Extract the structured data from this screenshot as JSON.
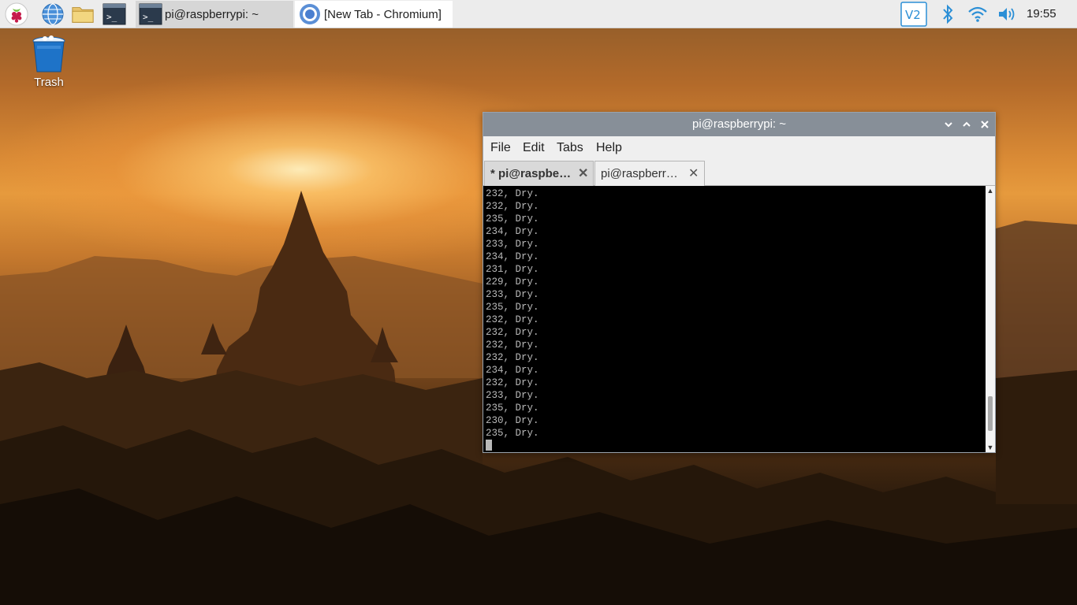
{
  "taskbar": {
    "launchers": [
      {
        "icon": "raspberry-menu-icon"
      },
      {
        "icon": "web-browser-icon"
      },
      {
        "icon": "file-manager-icon"
      },
      {
        "icon": "terminal-icon"
      }
    ],
    "tasks": [
      {
        "icon": "terminal-icon",
        "label": "pi@raspberrypi: ~"
      },
      {
        "icon": "chromium-icon",
        "label": "[New Tab - Chromium]"
      }
    ],
    "tray": [
      {
        "icon": "vnc-icon"
      },
      {
        "icon": "bluetooth-icon"
      },
      {
        "icon": "wifi-icon"
      },
      {
        "icon": "volume-icon"
      }
    ],
    "clock": "19:55"
  },
  "desktop": {
    "trash_label": "Trash"
  },
  "terminal": {
    "title": "pi@raspberrypi: ~",
    "menu": [
      "File",
      "Edit",
      "Tabs",
      "Help"
    ],
    "tabs": [
      {
        "label": "* pi@raspbe…",
        "active": true
      },
      {
        "label": "pi@raspberr…",
        "active": false
      }
    ],
    "output_lines": [
      "232, Dry.",
      "232, Dry.",
      "235, Dry.",
      "234, Dry.",
      "233, Dry.",
      "234, Dry.",
      "231, Dry.",
      "229, Dry.",
      "233, Dry.",
      "235, Dry.",
      "232, Dry.",
      "232, Dry.",
      "232, Dry.",
      "232, Dry.",
      "234, Dry.",
      "232, Dry.",
      "233, Dry.",
      "235, Dry.",
      "230, Dry.",
      "235, Dry."
    ],
    "scroll_position": 0.95
  },
  "colors": {
    "taskbar_bg": "#ececec",
    "title_bar": "#878f98",
    "terminal_bg": "#000000",
    "terminal_fg": "#b9b9b9"
  }
}
